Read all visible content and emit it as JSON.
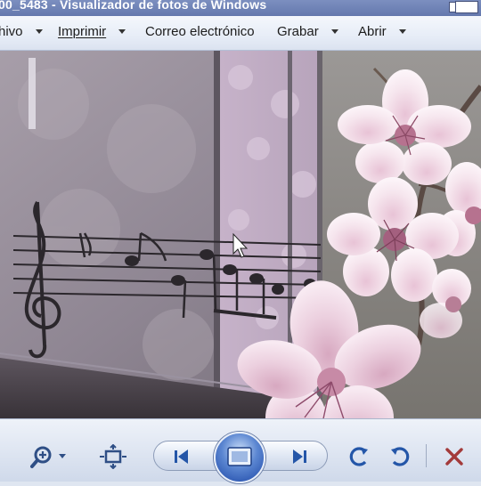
{
  "window": {
    "title": "00_5483 - Visualizador de fotos de Windows"
  },
  "menu": {
    "items": [
      {
        "label": "hivo"
      },
      {
        "label": "Imprimir"
      },
      {
        "label": "Correo electrónico"
      },
      {
        "label": "Grabar"
      },
      {
        "label": "Abrir"
      }
    ]
  },
  "toolbar": {
    "icons": [
      "zoom-icon",
      "actual-size-icon",
      "previous-icon",
      "slideshow-icon",
      "next-icon",
      "rotate-counterclockwise-icon",
      "rotate-clockwise-icon",
      "delete-icon"
    ]
  },
  "photo": {
    "subject": "music-staff-and-cherry-blossoms"
  },
  "colors": {
    "titlebar": "#6a7db2",
    "menubar": "#e7edf7",
    "accent_blue": "#1c47a7",
    "delete_red": "#a33a3a",
    "blossom_pink": "#f0d4e4"
  }
}
